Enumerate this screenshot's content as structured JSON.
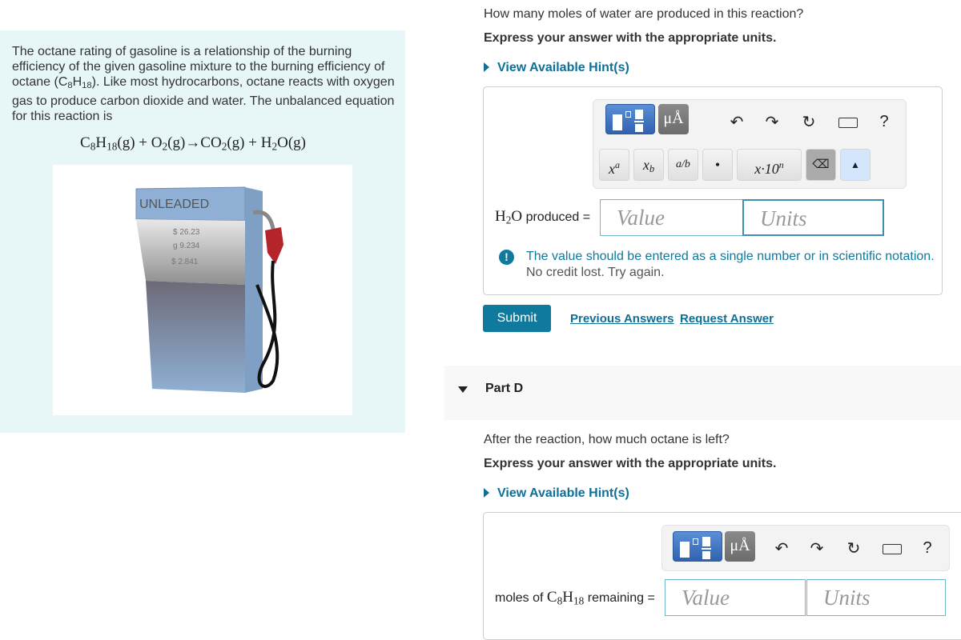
{
  "left": {
    "intro": "The octane rating of gasoline is a relationship of the burning efficiency of the given gasoline mixture to the burning efficiency of octane (C8H18). Like most hydrocarbons, octane reacts with oxygen gas to produce carbon dioxide and water. The unbalanced equation for this reaction is",
    "intro_a": "The octane rating of gasoline is a relationship of the burning efficiency of the given gasoline mixture to the burning efficiency of octane (C",
    "intro_b": "). Like most hydrocarbons, octane reacts with oxygen gas to produce carbon dioxide and water. The unbalanced equation for this reaction is",
    "equation": "C8H18(g)+O2(g)→CO2(g)+H2O(g)",
    "image": {
      "pump_label": "UNLEADED",
      "price": "$ 26.23",
      "gallons": "g 9.234",
      "rate": "$ 2.841"
    }
  },
  "partC": {
    "question": "How many moles of water are produced in this reaction?",
    "instruction": "Express your answer with the appropriate units.",
    "hint": "View Available Hint(s)",
    "toolbar": {
      "units_btn": "μÅ",
      "undo": "undo-icon",
      "redo": "redo-icon",
      "reset": "reset-icon",
      "keyboard": "keyboard-icon",
      "help": "?",
      "keys": [
        "xᵃ",
        "x_b",
        "a/b",
        "•",
        "x·10ⁿ"
      ]
    },
    "label_suffix": "produced =",
    "value_placeholder": "Value",
    "units_placeholder": "Units",
    "feedback": "The value should be entered as a single number or in scientific notation.",
    "feedback2": "No credit lost. Try again.",
    "submit": "Submit",
    "previous": "Previous Answers",
    "request": "Request Answer"
  },
  "partD": {
    "title": "Part D",
    "question": "After the reaction, how much octane is left?",
    "instruction": "Express your answer with the appropriate units.",
    "hint": "View Available Hint(s)",
    "toolbar": {
      "units_btn": "μÅ",
      "help": "?"
    },
    "label_prefix": "moles of",
    "label_suffix": "remaining =",
    "value_placeholder": "Value",
    "units_placeholder": "Units"
  },
  "colors": {
    "accent": "#0f7a9e",
    "panel": "#e7f6f7",
    "template": "#3a6fc0"
  }
}
